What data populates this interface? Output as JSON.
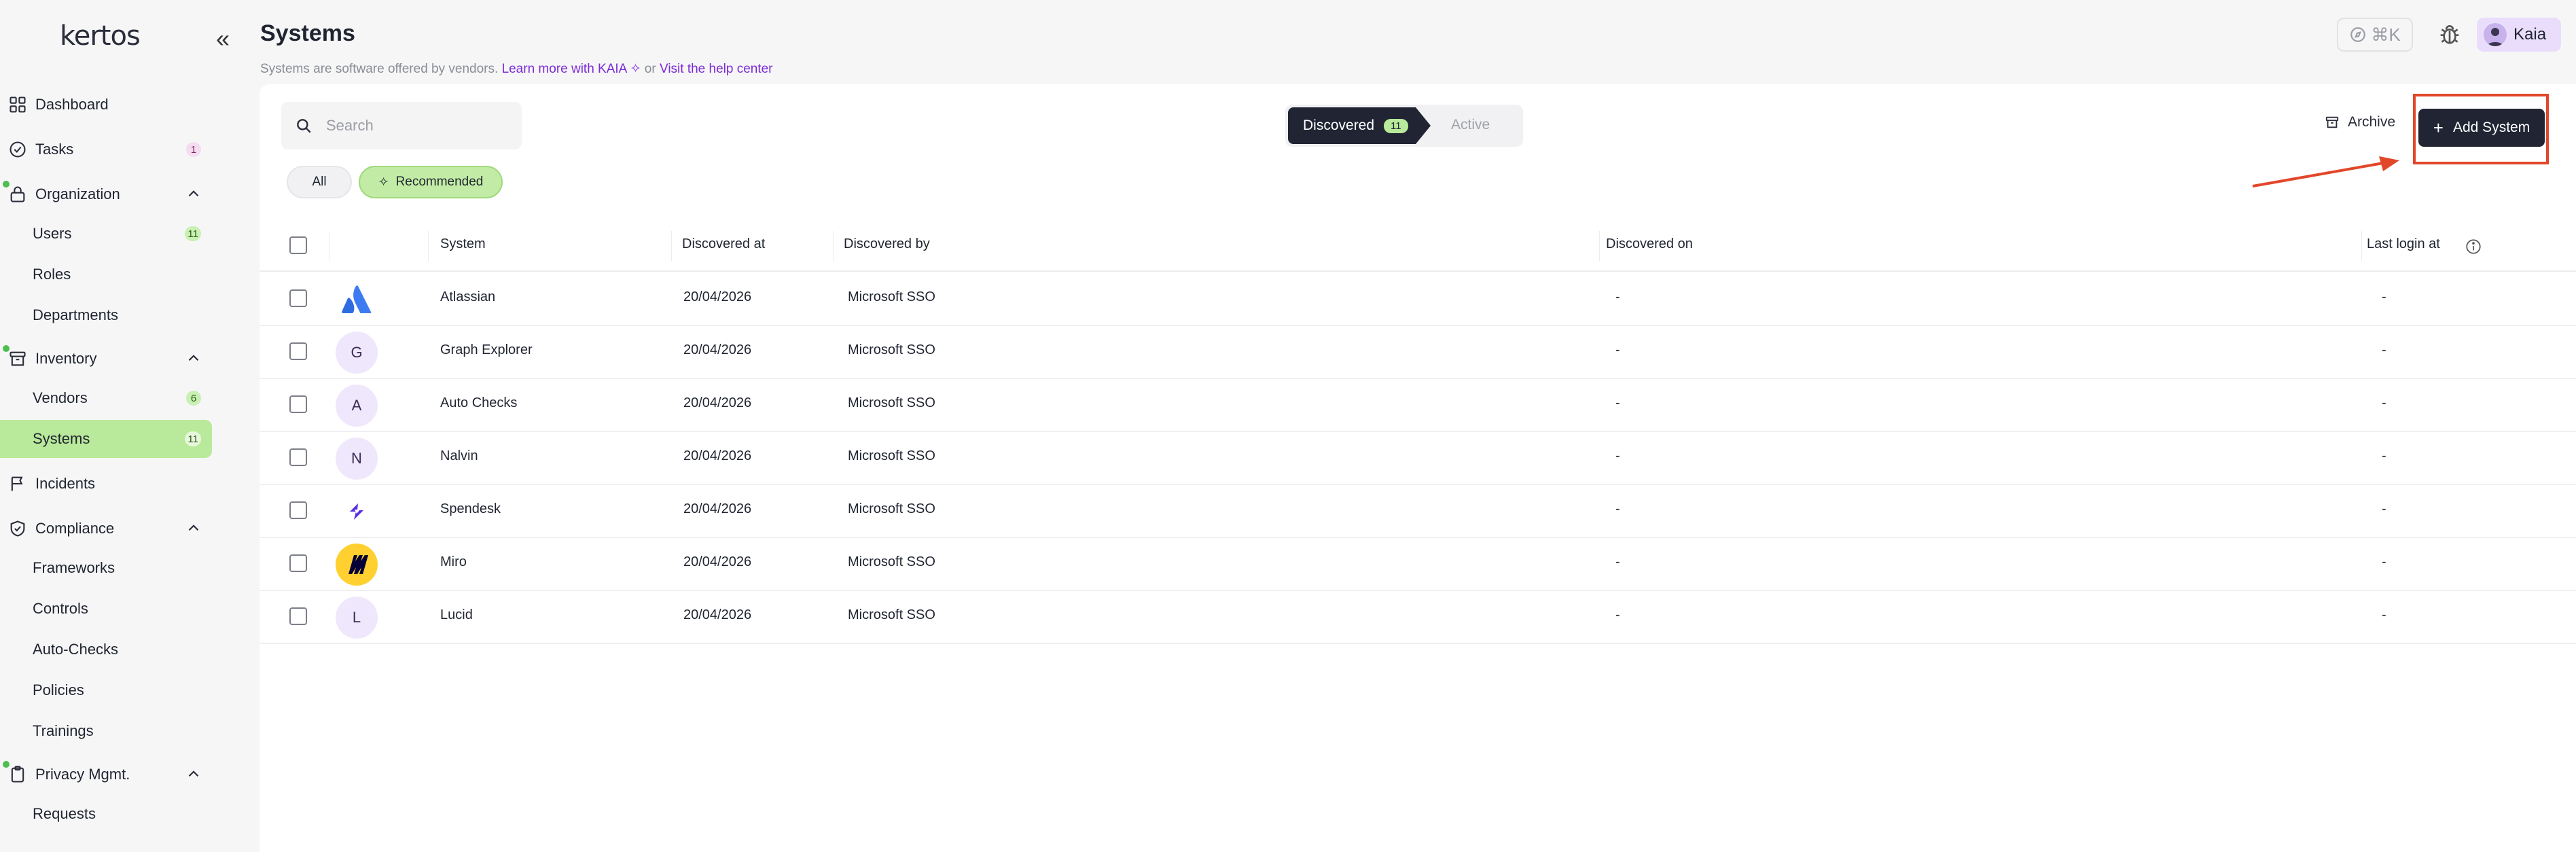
{
  "sidebar": {
    "logo": "kertos",
    "items": [
      {
        "label": "Dashboard"
      },
      {
        "label": "Tasks",
        "count": "1"
      },
      {
        "label": "Organization"
      },
      {
        "label": "Users",
        "count": "11"
      },
      {
        "label": "Roles"
      },
      {
        "label": "Departments"
      },
      {
        "label": "Inventory"
      },
      {
        "label": "Vendors",
        "count": "6"
      },
      {
        "label": "Systems",
        "count": "11"
      },
      {
        "label": "Incidents"
      },
      {
        "label": "Compliance"
      },
      {
        "label": "Frameworks"
      },
      {
        "label": "Controls"
      },
      {
        "label": "Auto-Checks"
      },
      {
        "label": "Policies"
      },
      {
        "label": "Trainings"
      },
      {
        "label": "Privacy Mgmt."
      },
      {
        "label": "Requests"
      }
    ]
  },
  "header": {
    "title": "Systems",
    "subtitle_text": "Systems are software offered by vendors.",
    "learn_more": "Learn more with KAIA",
    "or": "or",
    "help_link": "Visit the help center",
    "shortcut": "⌘K",
    "user_name": "Kaia"
  },
  "toolbar": {
    "search_placeholder": "Search",
    "tab_discovered": "Discovered",
    "discovered_count": "11",
    "tab_active": "Active",
    "archive_label": "Archive",
    "add_label": "Add System",
    "filter_all": "All",
    "filter_recommended": "Recommended"
  },
  "table": {
    "columns": [
      "System",
      "Discovered at",
      "Discovered by",
      "Discovered on",
      "Last login at"
    ],
    "rows": [
      {
        "logo": "atlassian-logo",
        "system": "Atlassian",
        "discovered_at": "20/04/2026",
        "discovered_by": "Microsoft SSO",
        "discovered_on": "-",
        "last_login": "-"
      },
      {
        "logo": "G",
        "system": "Graph Explorer",
        "discovered_at": "20/04/2026",
        "discovered_by": "Microsoft SSO",
        "discovered_on": "-",
        "last_login": "-"
      },
      {
        "logo": "A",
        "system": "Auto Checks",
        "discovered_at": "20/04/2026",
        "discovered_by": "Microsoft SSO",
        "discovered_on": "-",
        "last_login": "-"
      },
      {
        "logo": "N",
        "system": "Nalvin",
        "discovered_at": "20/04/2026",
        "discovered_by": "Microsoft SSO",
        "discovered_on": "-",
        "last_login": "-"
      },
      {
        "logo": "spendesk-logo",
        "system": "Spendesk",
        "discovered_at": "20/04/2026",
        "discovered_by": "Microsoft SSO",
        "discovered_on": "-",
        "last_login": "-"
      },
      {
        "logo": "miro-logo",
        "system": "Miro",
        "discovered_at": "20/04/2026",
        "discovered_by": "Microsoft SSO",
        "discovered_on": "-",
        "last_login": "-"
      },
      {
        "logo": "L",
        "system": "Lucid",
        "discovered_at": "20/04/2026",
        "discovered_by": "Microsoft SSO",
        "discovered_on": "-",
        "last_login": "-"
      }
    ]
  },
  "colors": {
    "accent_dark": "#202433",
    "accent_green": "#b9e99a",
    "link_purple": "#7a2bd6",
    "highlight_red": "#e2472a"
  }
}
